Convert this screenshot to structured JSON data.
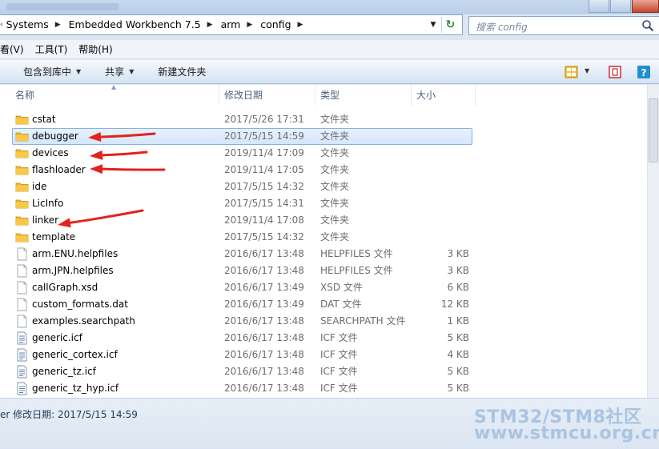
{
  "address": {
    "crumbs": [
      "Systems",
      "Embedded Workbench 7.5",
      "arm",
      "config"
    ]
  },
  "search": {
    "placeholder": "搜索 config"
  },
  "menu": [
    {
      "label": "看(V)"
    },
    {
      "label": "工具(T)"
    },
    {
      "label": "帮助(H)"
    }
  ],
  "toolbar": {
    "include_label": "包含到库中",
    "share_label": "共享",
    "new_folder_label": "新建文件夹"
  },
  "columns": {
    "name": "名称",
    "date": "修改日期",
    "type": "类型",
    "size": "大小"
  },
  "files": [
    {
      "name": "cstat",
      "date": "2017/5/26 17:31",
      "type": "文件夹",
      "size": "",
      "kind": "folder"
    },
    {
      "name": "debugger",
      "date": "2017/5/15 14:59",
      "type": "文件夹",
      "size": "",
      "kind": "folder",
      "selected": true
    },
    {
      "name": "devices",
      "date": "2019/11/4 17:09",
      "type": "文件夹",
      "size": "",
      "kind": "folder"
    },
    {
      "name": "flashloader",
      "date": "2019/11/4 17:05",
      "type": "文件夹",
      "size": "",
      "kind": "folder"
    },
    {
      "name": "ide",
      "date": "2017/5/15 14:32",
      "type": "文件夹",
      "size": "",
      "kind": "folder"
    },
    {
      "name": "LicInfo",
      "date": "2017/5/15 14:31",
      "type": "文件夹",
      "size": "",
      "kind": "folder"
    },
    {
      "name": "linker",
      "date": "2019/11/4 17:08",
      "type": "文件夹",
      "size": "",
      "kind": "folder"
    },
    {
      "name": "template",
      "date": "2017/5/15 14:32",
      "type": "文件夹",
      "size": "",
      "kind": "folder"
    },
    {
      "name": "arm.ENU.helpfiles",
      "date": "2016/6/17 13:48",
      "type": "HELPFILES 文件",
      "size": "3 KB",
      "kind": "file"
    },
    {
      "name": "arm.JPN.helpfiles",
      "date": "2016/6/17 13:48",
      "type": "HELPFILES 文件",
      "size": "3 KB",
      "kind": "file"
    },
    {
      "name": "callGraph.xsd",
      "date": "2016/6/17 13:49",
      "type": "XSD 文件",
      "size": "6 KB",
      "kind": "file"
    },
    {
      "name": "custom_formats.dat",
      "date": "2016/6/17 13:49",
      "type": "DAT 文件",
      "size": "12 KB",
      "kind": "file"
    },
    {
      "name": "examples.searchpath",
      "date": "2016/6/17 13:48",
      "type": "SEARCHPATH 文件",
      "size": "1 KB",
      "kind": "file"
    },
    {
      "name": "generic.icf",
      "date": "2016/6/17 13:48",
      "type": "ICF 文件",
      "size": "5 KB",
      "kind": "icf"
    },
    {
      "name": "generic_cortex.icf",
      "date": "2016/6/17 13:48",
      "type": "ICF 文件",
      "size": "4 KB",
      "kind": "icf"
    },
    {
      "name": "generic_tz.icf",
      "date": "2016/6/17 13:48",
      "type": "ICF 文件",
      "size": "5 KB",
      "kind": "icf"
    },
    {
      "name": "generic_tz_hyp.icf",
      "date": "2016/6/17 13:48",
      "type": "ICF 文件",
      "size": "5 KB",
      "kind": "icf"
    }
  ],
  "status": {
    "text": "er  修改日期: 2017/5/15 14:59"
  },
  "watermark": {
    "line1": "STM32/STM8社区",
    "line2": "www.stmcu.org.cn"
  },
  "colors": {
    "arrow": "#e3231b",
    "folder": "#f0b52b",
    "selection": "#d4e6fb"
  },
  "icons": {
    "folder": "folder-icon",
    "file": "file-icon",
    "icf": "icf-file-icon",
    "search": "search-icon",
    "refresh": "refresh-icon",
    "help": "help-icon"
  }
}
